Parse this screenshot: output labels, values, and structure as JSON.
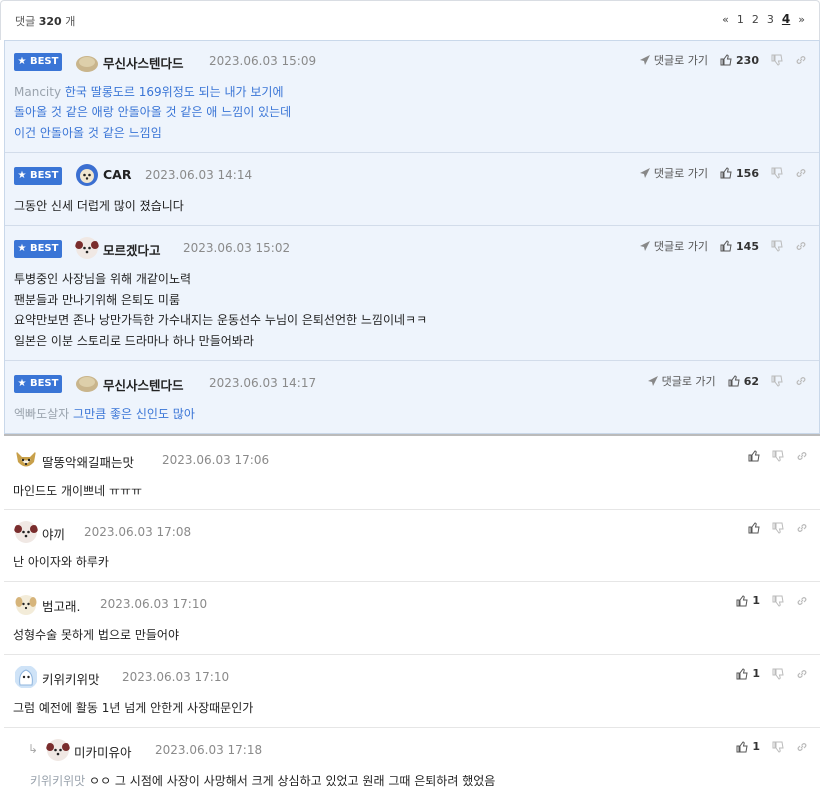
{
  "header": {
    "count_label": "댓글",
    "count_value": "320",
    "count_unit": "개",
    "pager": {
      "first": "«",
      "pages": [
        "1",
        "2",
        "3"
      ],
      "current": "4",
      "last": "»"
    }
  },
  "best_comments": [
    {
      "badge": "★ BEST",
      "nick": "무신사스텐다드",
      "date": "2023.06.03 15:09",
      "goto": "댓글로 가기",
      "likes": "230",
      "lines": [
        {
          "reply_to": "Mancity",
          "text": "한국 딸롱도르 169위정도 되는 내가 보기에"
        },
        {
          "text": "돌아올 것 같은 애랑 안돌아올 것 같은 애 느낌이 있는데"
        },
        {
          "text": "이건 안돌아올 것 같은 느낌임"
        }
      ]
    },
    {
      "badge": "★ BEST",
      "nick": "CAR",
      "date": "2023.06.03 14:14",
      "goto": "댓글로 가기",
      "likes": "156",
      "lines": [
        {
          "text": "그동안 신세 더럽게 많이 졌습니다"
        }
      ]
    },
    {
      "badge": "★ BEST",
      "nick": "모르겠다고",
      "date": "2023.06.03 15:02",
      "goto": "댓글로 가기",
      "likes": "145",
      "lines": [
        {
          "text": "투병중인 사장님을 위해 개같이노력"
        },
        {
          "text": "팬분들과 만나기위해 은퇴도 미룸"
        },
        {
          "text": "요약만보면 존나 낭만가득한 가수내지는 운동선수 누님이 은퇴선언한 느낌이네ㅋㅋ"
        },
        {
          "text": "일본은 이분 스토리로 드라마나 하나 만들어봐라"
        }
      ]
    },
    {
      "badge": "★ BEST",
      "nick": "무신사스텐다드",
      "date": "2023.06.03 14:17",
      "goto": "댓글로 가기",
      "likes": "62",
      "lines": [
        {
          "reply_to": "엑빠도살자",
          "text": "그만큼 좋은 신인도 많아"
        }
      ]
    }
  ],
  "comments": [
    {
      "nick": "딸똥악왜길패는맛",
      "date": "2023.06.03 17:06",
      "likes": "",
      "text": "마인드도 개이쁘네 ㅠㅠㅠ"
    },
    {
      "nick": "야끼",
      "date": "2023.06.03 17:08",
      "likes": "",
      "text": "난 아이자와 하루카"
    },
    {
      "nick": "범고래.",
      "date": "2023.06.03 17:10",
      "likes": "1",
      "text": "성형수술 못하게 법으로 만들어야"
    },
    {
      "nick": "키위키위맛",
      "date": "2023.06.03 17:10",
      "likes": "1",
      "text": "그럼 예전에 활동 1년 넘게 안한게 사장때문인가"
    },
    {
      "nick": "미카미유아",
      "date": "2023.06.03 17:18",
      "likes": "1",
      "reply_to": "키위키위맛",
      "text": "ㅇㅇ 그 시점에 사장이 사망해서 크게 상심하고 있었고 원래 그때 은퇴하려 했었음"
    }
  ],
  "colors": {
    "accent": "#3a75d6",
    "best_bg": "#eef4fc"
  },
  "icons": {
    "goto": "send-arrow-icon",
    "like": "thumbs-up-icon",
    "dislike": "thumbs-down-icon",
    "share": "link-icon"
  }
}
